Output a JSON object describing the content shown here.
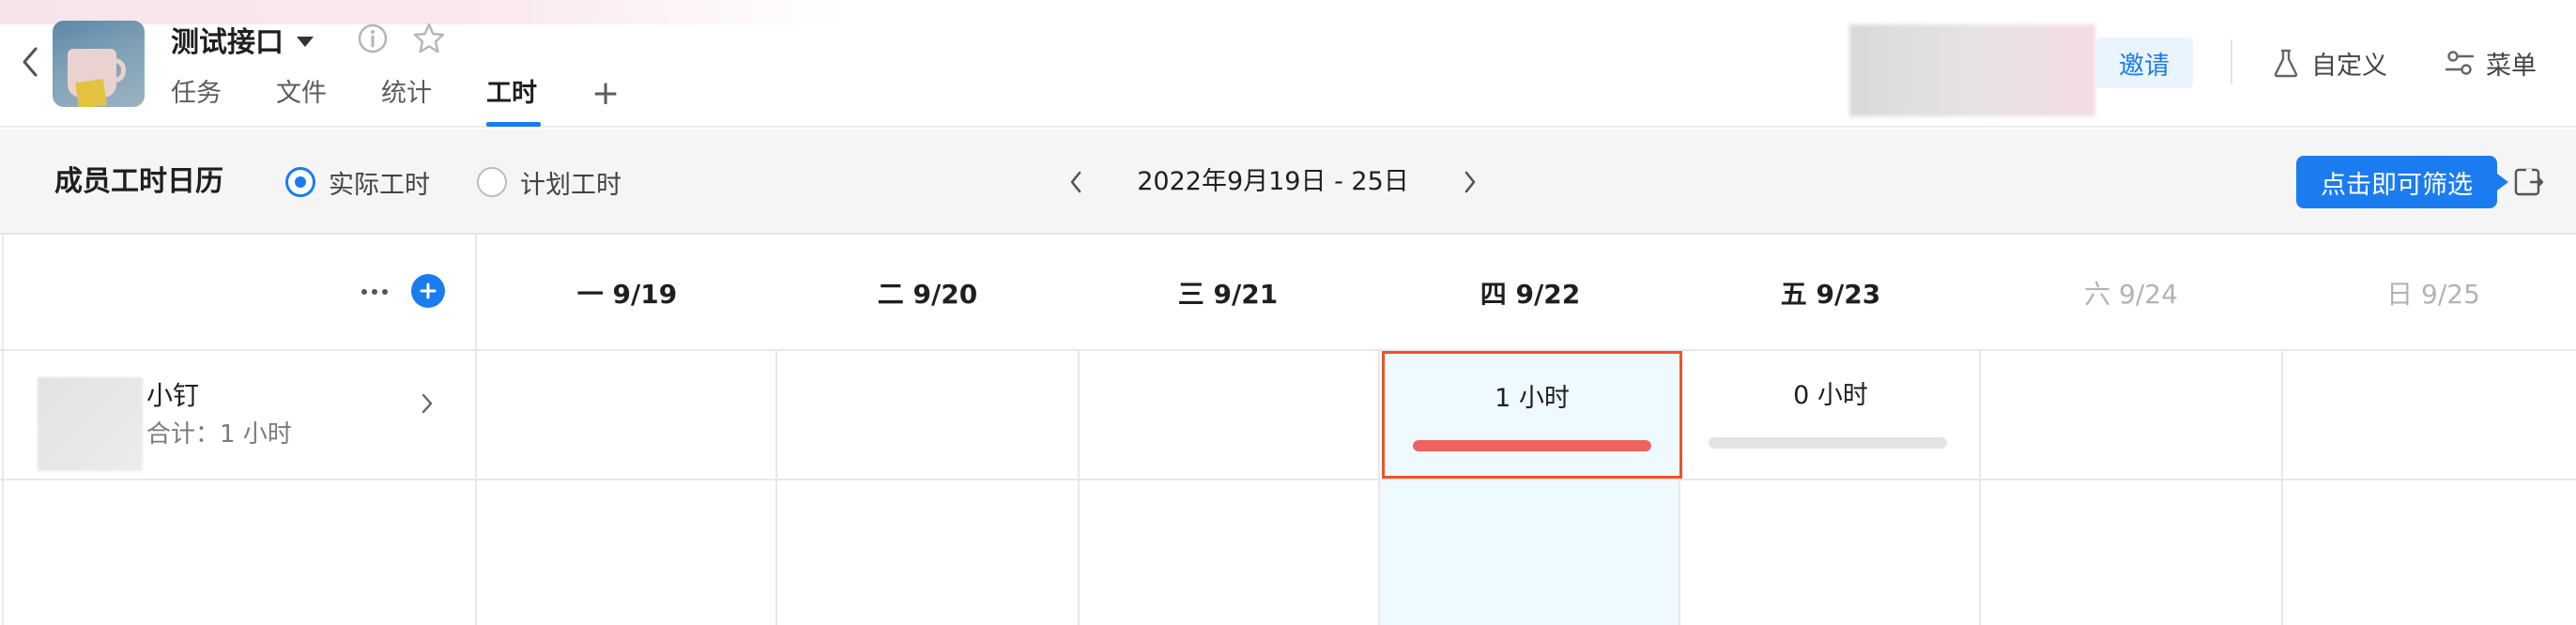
{
  "header": {
    "project_name": "测试接口",
    "tabs": [
      {
        "label": "任务"
      },
      {
        "label": "文件"
      },
      {
        "label": "统计"
      },
      {
        "label": "工时"
      }
    ],
    "active_tab": "工时",
    "tab_add": "+",
    "invite_label": "邀请",
    "custom_label": "自定义",
    "menu_label": "菜单"
  },
  "toolbar": {
    "title": "成员工时日历",
    "radio_actual": "实际工时",
    "radio_planned": "计划工时",
    "selected_mode": "实际工时",
    "date_range": "2022年9月19日 - 25日",
    "filter_tip": "点击即可筛选"
  },
  "calendar": {
    "days": [
      {
        "label": "一 9/19",
        "weekend": false
      },
      {
        "label": "二 9/20",
        "weekend": false
      },
      {
        "label": "三 9/21",
        "weekend": false
      },
      {
        "label": "四 9/22",
        "weekend": false
      },
      {
        "label": "五 9/23",
        "weekend": false
      },
      {
        "label": "六 9/24",
        "weekend": true
      },
      {
        "label": "日 9/25",
        "weekend": true
      }
    ],
    "members": [
      {
        "name": "小钉",
        "total": "合计：1 小时",
        "entries": [
          {
            "day": "四 9/22",
            "hours_text": "1 小时",
            "progress": 1.0,
            "bar_color": "#f0625f",
            "selected": true
          },
          {
            "day": "五 9/23",
            "hours_text": "0 小时",
            "progress": 0.0,
            "bar_color": "#f0625f",
            "selected": false
          }
        ]
      }
    ]
  },
  "colors": {
    "accent": "#1b7cf0",
    "selected_border": "#ee5327",
    "today_column": "#eefaff",
    "bar_fill": "#f0625f"
  }
}
